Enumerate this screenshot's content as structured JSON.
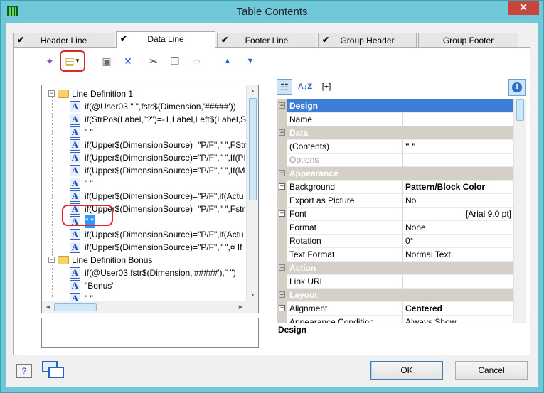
{
  "window": {
    "title": "Table Contents",
    "close_glyph": "✕"
  },
  "tabs": [
    {
      "label": "Header Line",
      "checked": true,
      "active": false
    },
    {
      "label": "Data Line",
      "checked": true,
      "active": true
    },
    {
      "label": "Footer Line",
      "checked": true,
      "active": false
    },
    {
      "label": "Group Header",
      "checked": true,
      "active": false
    },
    {
      "label": "Group Footer",
      "checked": false,
      "active": false
    }
  ],
  "toolbar": {
    "items": [
      {
        "icon": "wizard-icon",
        "glyph": "✦",
        "enabled": true
      },
      {
        "icon": "new-item-icon",
        "glyph": "▤",
        "enabled": true,
        "highlighted": true
      },
      {
        "icon": "properties-icon",
        "glyph": "▣",
        "enabled": true
      },
      {
        "icon": "delete-icon",
        "glyph": "✕",
        "enabled": true
      },
      {
        "icon": "cut-icon",
        "glyph": "✂",
        "enabled": true
      },
      {
        "icon": "copy-icon",
        "glyph": "❐",
        "enabled": true
      },
      {
        "icon": "paste-icon",
        "glyph": "📋",
        "enabled": false
      },
      {
        "icon": "move-up-icon",
        "glyph": "▲",
        "enabled": true
      },
      {
        "icon": "move-down-icon",
        "glyph": "▼",
        "enabled": true
      }
    ]
  },
  "tree": {
    "rows": [
      {
        "type": "folder",
        "text": "Line Definition 1",
        "level": 0
      },
      {
        "type": "field",
        "text": "if(@User03,\" \",fstr$(Dimension,'#####'))",
        "level": 1
      },
      {
        "type": "field",
        "text": "if(StrPos(Label,\"?\")=-1,Label,Left$(Label,Str",
        "level": 1
      },
      {
        "type": "field",
        "text": "\" \"",
        "level": 1
      },
      {
        "type": "field",
        "text": "if(Upper$(DimensionSource)=\"P/F\",\" \",FStr",
        "level": 1
      },
      {
        "type": "field",
        "text": "if(Upper$(DimensionSource)=\"P/F\",\" \",If(PI",
        "level": 1
      },
      {
        "type": "field",
        "text": "if(Upper$(DimensionSource)=\"P/F\",\" \",If(M",
        "level": 1
      },
      {
        "type": "field",
        "text": "\" \"",
        "level": 1
      },
      {
        "type": "field",
        "text": "if(Upper$(DimensionSource)=\"P/F\",if(Actu",
        "level": 1
      },
      {
        "type": "field",
        "text": "if(Upper$(DimensionSource)=\"P/F\",\" \",Fstr",
        "level": 1
      },
      {
        "type": "field",
        "text": "\" \"",
        "level": 1,
        "selected": true
      },
      {
        "type": "field",
        "text": "if(Upper$(DimensionSource)=\"P/F\",if(Actu",
        "level": 1
      },
      {
        "type": "field",
        "text": "if(Upper$(DimensionSource)=\"P/F\",\" \",¤  If",
        "level": 1
      },
      {
        "type": "folder",
        "text": "Line Definition Bonus",
        "level": 0
      },
      {
        "type": "field",
        "text": "if(@User03,fstr$(Dimension,'#####'),\" \")",
        "level": 1
      },
      {
        "type": "field",
        "text": "\"Bonus\"",
        "level": 1
      },
      {
        "type": "field",
        "text": "\" \"",
        "level": 1
      }
    ]
  },
  "properties": {
    "rows": [
      {
        "kind": "category",
        "name": "Design",
        "selected": true
      },
      {
        "kind": "prop",
        "name": "Name",
        "value": ""
      },
      {
        "kind": "category",
        "name": "Data"
      },
      {
        "kind": "prop",
        "name": "(Contents)",
        "value": "\" \"",
        "bold": true
      },
      {
        "kind": "prop",
        "name": "Options",
        "value": "",
        "grey": true
      },
      {
        "kind": "category",
        "name": "Appearance"
      },
      {
        "kind": "prop",
        "name": "Background",
        "value": "Pattern/Block Color",
        "bold": true,
        "expandable": true
      },
      {
        "kind": "prop",
        "name": "Export as Picture",
        "value": "No"
      },
      {
        "kind": "prop",
        "name": "Font",
        "value": "[Arial 9.0 pt]",
        "expandable": true,
        "right": true
      },
      {
        "kind": "prop",
        "name": "Format",
        "value": "None"
      },
      {
        "kind": "prop",
        "name": "Rotation",
        "value": "0°"
      },
      {
        "kind": "prop",
        "name": "Text Format",
        "value": "Normal Text"
      },
      {
        "kind": "category",
        "name": "Action"
      },
      {
        "kind": "prop",
        "name": "Link URL",
        "value": ""
      },
      {
        "kind": "category",
        "name": "Layout"
      },
      {
        "kind": "prop",
        "name": "Alignment",
        "value": "Centered",
        "bold": true,
        "expandable": true
      },
      {
        "kind": "prop",
        "name": "Appearance Condition",
        "value": "Always Show"
      }
    ],
    "description_title": "Design"
  },
  "prop_toolbar": {
    "categorized_glyph": "☷",
    "sort_label": "A↓Z",
    "expand_label": "[+]",
    "info_glyph": "i"
  },
  "footer": {
    "help_glyph": "?",
    "ok_label": "OK",
    "cancel_label": "Cancel"
  }
}
